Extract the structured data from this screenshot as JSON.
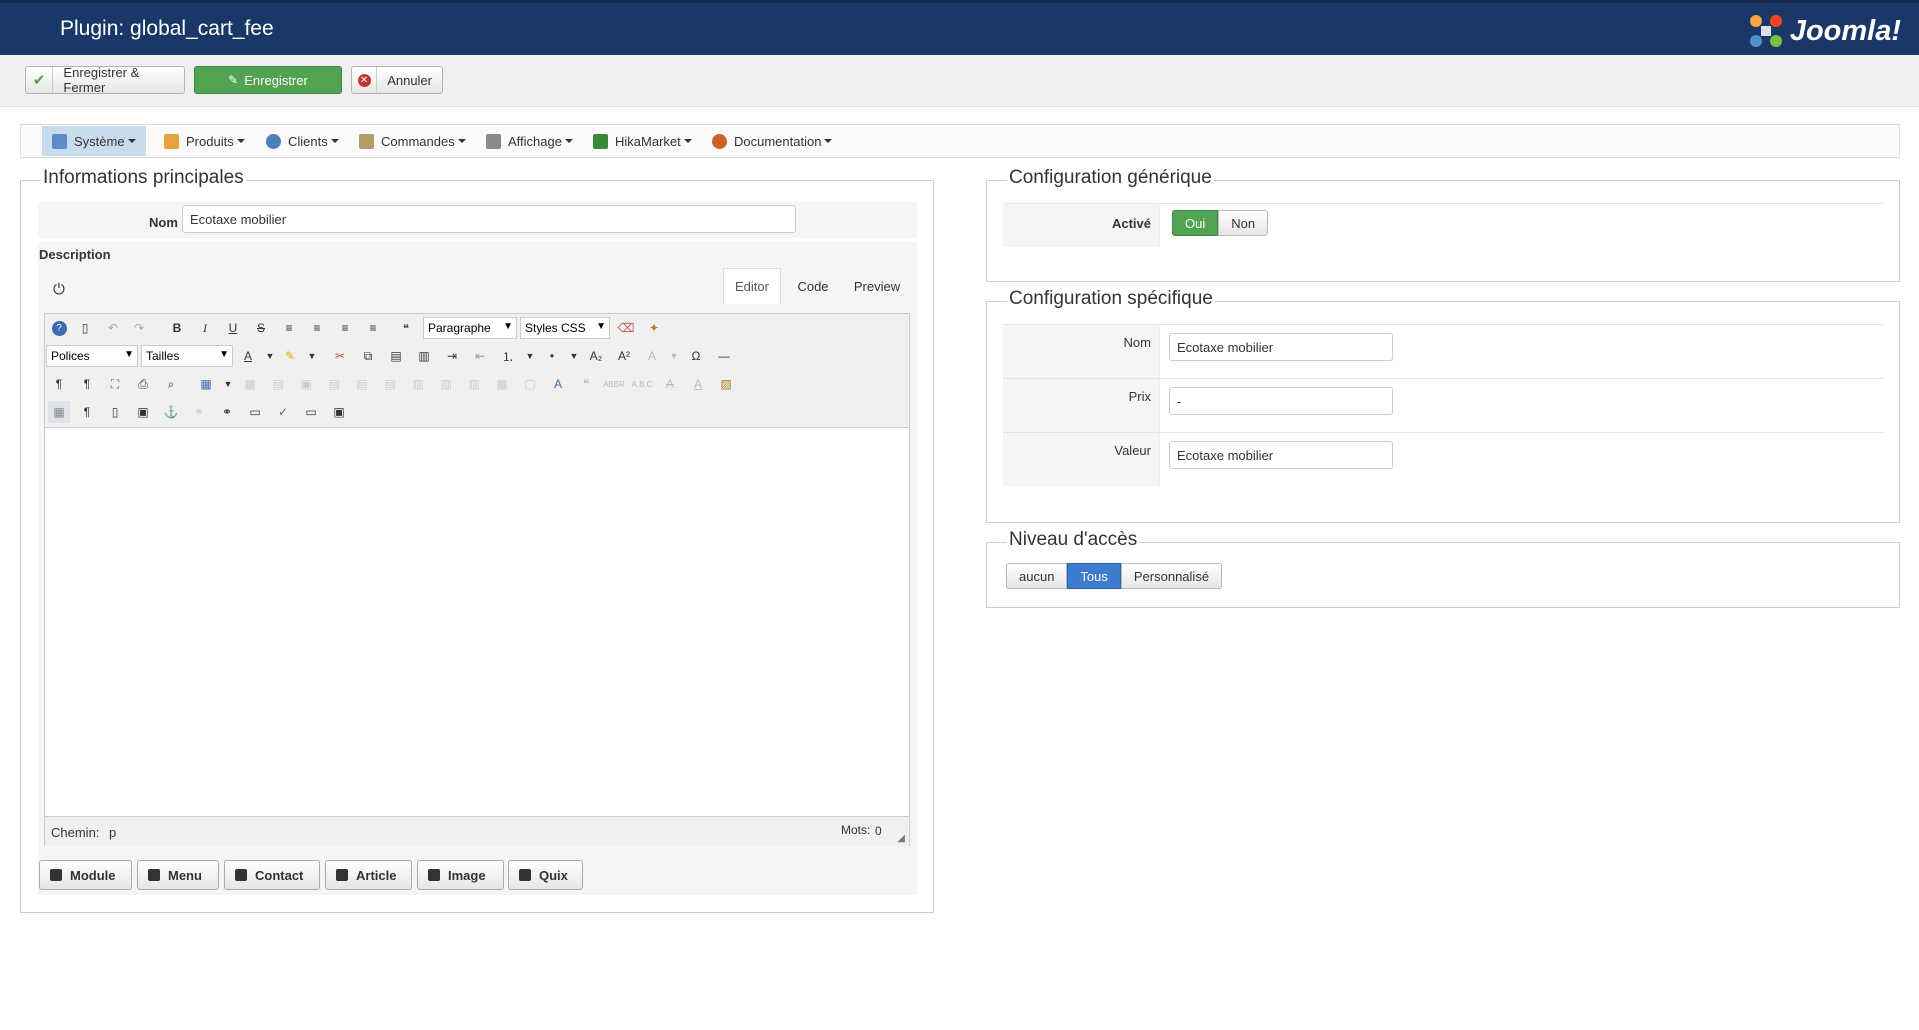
{
  "header": {
    "title": "Plugin: global_cart_fee",
    "logo_text": "Joomla!"
  },
  "toolbar": {
    "save_close": "Enregistrer & Fermer",
    "save": "Enregistrer",
    "cancel": "Annuler"
  },
  "nav": {
    "items": [
      {
        "label": "Système",
        "icon": "wrench-icon",
        "color": "#5b8cc6"
      },
      {
        "label": "Produits",
        "icon": "box-icon",
        "color": "#e6a23c"
      },
      {
        "label": "Clients",
        "icon": "users-icon",
        "color": "#4a7fb8"
      },
      {
        "label": "Commandes",
        "icon": "orders-icon",
        "color": "#b59a6a"
      },
      {
        "label": "Affichage",
        "icon": "display-icon",
        "color": "#8a8a8a"
      },
      {
        "label": "HikaMarket",
        "icon": "hikamarket-icon",
        "color": "#3a8a3a"
      },
      {
        "label": "Documentation",
        "icon": "lifebuoy-icon",
        "color": "#d0602a"
      }
    ]
  },
  "main": {
    "legend": "Informations principales",
    "name_label": "Nom",
    "name_value": "Ecotaxe mobilier",
    "description_label": "Description",
    "tabs": [
      "Editor",
      "Code",
      "Preview"
    ],
    "editor": {
      "paragraph": "Paragraphe",
      "styles": "Styles CSS",
      "fonts": "Polices",
      "sizes": "Tailles",
      "path_label": "Chemin:",
      "path_value": "p",
      "words_label": "Mots:",
      "words_value": "0"
    },
    "extra_buttons": [
      "Module",
      "Menu",
      "Contact",
      "Article",
      "Image",
      "Quix"
    ]
  },
  "generic": {
    "legend": "Configuration générique",
    "active_label": "Activé",
    "yes": "Oui",
    "no": "Non"
  },
  "specific": {
    "legend": "Configuration spécifique",
    "fields": [
      {
        "label": "Nom",
        "value": "Ecotaxe mobilier"
      },
      {
        "label": "Prix",
        "value": "-"
      },
      {
        "label": "Valeur",
        "value": "Ecotaxe mobilier"
      }
    ]
  },
  "access": {
    "legend": "Niveau d'accès",
    "options": [
      "aucun",
      "Tous",
      "Personnalisé"
    ],
    "selected": "Tous"
  }
}
